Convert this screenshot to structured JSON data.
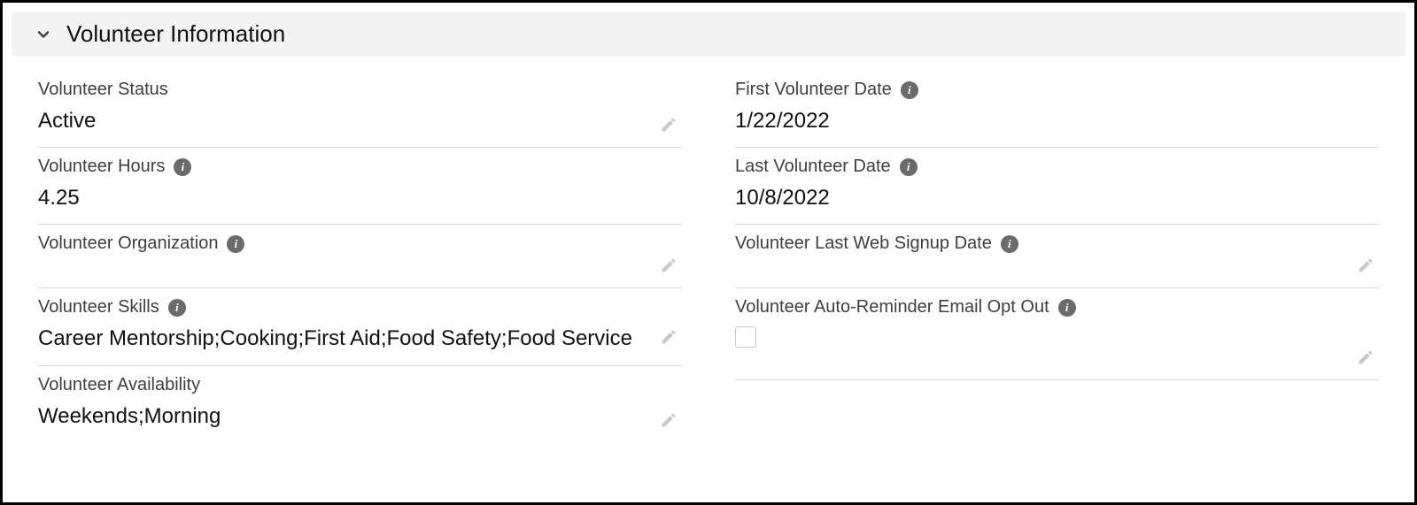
{
  "section": {
    "title": "Volunteer Information"
  },
  "fields": {
    "status": {
      "label": "Volunteer Status",
      "value": "Active",
      "help": false,
      "editable": true
    },
    "hours": {
      "label": "Volunteer Hours",
      "value": "4.25",
      "help": true,
      "editable": false
    },
    "organization": {
      "label": "Volunteer Organization",
      "value": "",
      "help": true,
      "editable": true
    },
    "skills": {
      "label": "Volunteer Skills",
      "value": "Career Mentorship;Cooking;First Aid;Food Safety;Food Service",
      "help": true,
      "editable": true
    },
    "availability": {
      "label": "Volunteer Availability",
      "value": "Weekends;Morning",
      "help": false,
      "editable": true
    },
    "first_date": {
      "label": "First Volunteer Date",
      "value": "1/22/2022",
      "help": true,
      "editable": false
    },
    "last_date": {
      "label": "Last Volunteer Date",
      "value": "10/8/2022",
      "help": true,
      "editable": false
    },
    "last_web_signup": {
      "label": "Volunteer Last Web Signup Date",
      "value": "",
      "help": true,
      "editable": true
    },
    "optout": {
      "label": "Volunteer Auto-Reminder Email Opt Out",
      "checked": false,
      "help": true,
      "editable": true
    }
  }
}
